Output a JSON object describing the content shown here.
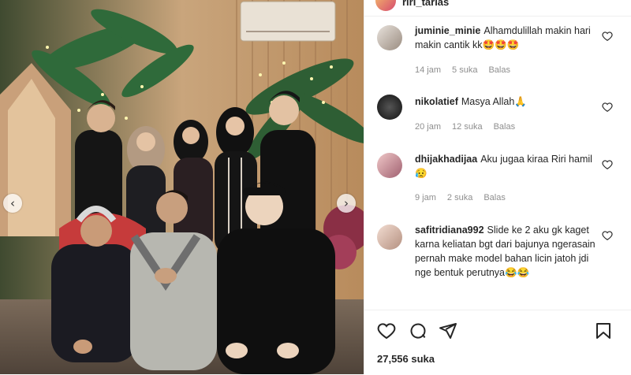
{
  "post": {
    "username": "riri_tarias"
  },
  "nav": {
    "prev": "‹",
    "next": "›"
  },
  "comments": [
    {
      "user": "juminie_minie",
      "text": "Alhamdulillah makin hari makin cantik kk🤩🤩🤩",
      "time": "14 jam",
      "likes": "5 suka",
      "reply": "Balas"
    },
    {
      "user": "nikolatief",
      "text": "Masya Allah🙏",
      "time": "20 jam",
      "likes": "12 suka",
      "reply": "Balas"
    },
    {
      "user": "dhijakhadijaa",
      "text": "Aku jugaa kiraa Riri hamil😥",
      "time": "9 jam",
      "likes": "2 suka",
      "reply": "Balas"
    },
    {
      "user": "safitridiana992",
      "text": "Slide ke 2 aku gk kaget karna keliatan bgt dari bajunya ngerasain pernah make model bahan licin jatoh jdi nge bentuk perutnya😂😂",
      "time": "",
      "likes": "",
      "reply": ""
    }
  ],
  "likes_count": "27,556 suka",
  "colors": {
    "text": "#262626",
    "meta": "#8e8e8e",
    "border": "#efefef"
  },
  "icons": [
    "heart-icon",
    "comment-icon",
    "share-icon",
    "bookmark-icon"
  ]
}
